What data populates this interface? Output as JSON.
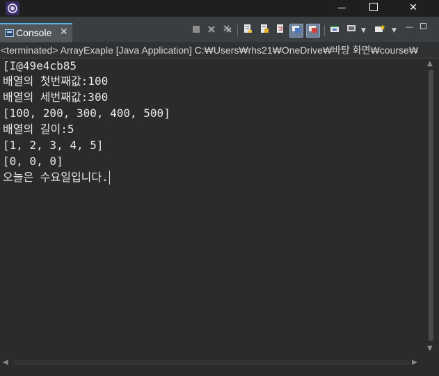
{
  "window": {
    "minimize_label": "—",
    "close_label": "✕"
  },
  "view": {
    "tab_label": "Console",
    "tab_close": "✕",
    "icons": [
      "terminate-icon",
      "remove-launch-icon",
      "remove-all-terminated-icon",
      "clear-console-icon",
      "scroll-lock-icon",
      "word-wrap-icon",
      "show-console-on-stdout-icon",
      "show-console-on-stderr-icon",
      "pin-console-icon",
      "display-selected-console-icon",
      "open-console-icon",
      "view-menu-icon"
    ]
  },
  "description": "<terminated> ArrayExaple [Java Application] C:₩Users₩rhs21₩OneDrive₩바탕 화면₩course₩",
  "console_lines": [
    "[I@49e4cb85",
    "배열의 첫번째값:100",
    "배열의 세번째값:300",
    "[100, 200, 300, 400, 500]",
    "배열의 길이:5",
    "[1, 2, 3, 4, 5]",
    "[0, 0, 0]",
    "오늘은 수요일입니다."
  ],
  "colors": {
    "background": "#2b2b2b",
    "text": "#e8e8e8",
    "tab_accent": "#5ab6f3"
  }
}
